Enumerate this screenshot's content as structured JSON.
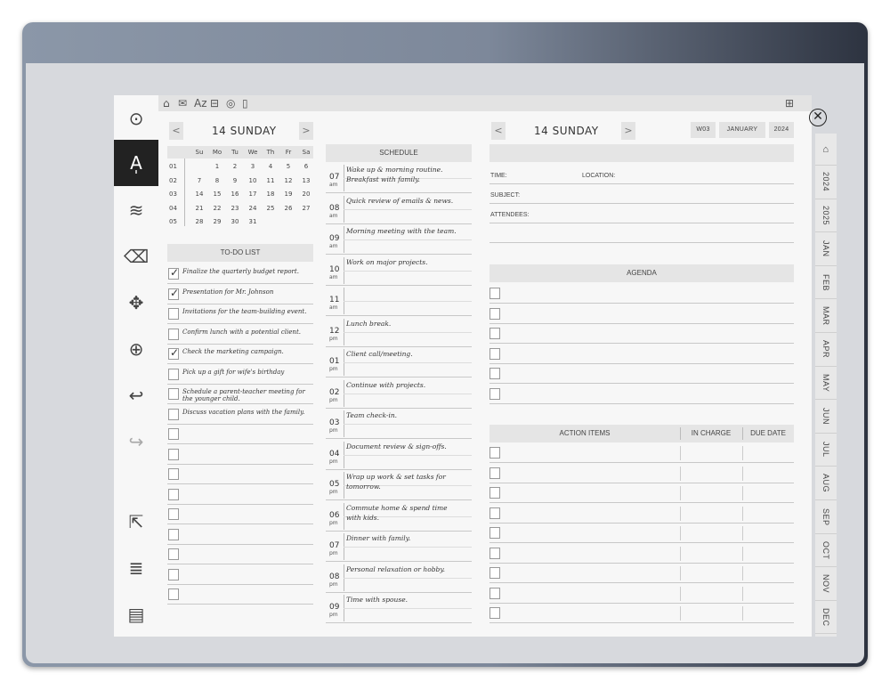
{
  "toolbar": {
    "icons": [
      "home-icon",
      "mail-icon",
      "sort-icon",
      "briefcase-icon",
      "target-icon",
      "document-icon",
      "grid-icon"
    ]
  },
  "rail": {
    "items": [
      "circle-dot-icon",
      "pen-icon",
      "brush-icon",
      "eraser-icon",
      "move-icon",
      "zoom-in-icon",
      "undo-icon",
      "redo-icon",
      "share-icon",
      "layers-icon",
      "notebook-icon"
    ]
  },
  "left_page": {
    "day_title": "14 SUNDAY",
    "prev": "<",
    "next": ">",
    "calendar": {
      "weekdays": [
        "Su",
        "Mo",
        "Tu",
        "We",
        "Th",
        "Fr",
        "Sa"
      ],
      "weeks": [
        {
          "num": "01",
          "days": [
            "",
            "1",
            "2",
            "3",
            "4",
            "5",
            "6"
          ]
        },
        {
          "num": "02",
          "days": [
            "7",
            "8",
            "9",
            "10",
            "11",
            "12",
            "13"
          ]
        },
        {
          "num": "03",
          "days": [
            "14",
            "15",
            "16",
            "17",
            "18",
            "19",
            "20"
          ]
        },
        {
          "num": "04",
          "days": [
            "21",
            "22",
            "23",
            "24",
            "25",
            "26",
            "27"
          ]
        },
        {
          "num": "05",
          "days": [
            "28",
            "29",
            "30",
            "31",
            "",
            "",
            ""
          ]
        }
      ]
    },
    "todo_title": "TO-DO LIST",
    "todos": [
      {
        "text": "Finalize the quarterly budget report.",
        "checked": true
      },
      {
        "text": "Presentation for Mr. Johnson",
        "checked": true
      },
      {
        "text": "Invitations for the team-building event.",
        "checked": false
      },
      {
        "text": "Confirm lunch with a potential client.",
        "checked": false
      },
      {
        "text": "Check the marketing campaign.",
        "checked": true
      },
      {
        "text": "Pick up a gift for wife's birthday",
        "checked": false
      },
      {
        "text": "Schedule a parent-teacher meeting for\nthe younger child.",
        "checked": false
      },
      {
        "text": "Discuss vacation plans with the family.",
        "checked": false
      },
      {
        "text": "",
        "checked": false
      },
      {
        "text": "",
        "checked": false
      },
      {
        "text": "",
        "checked": false
      },
      {
        "text": "",
        "checked": false
      },
      {
        "text": "",
        "checked": false
      },
      {
        "text": "",
        "checked": false
      },
      {
        "text": "",
        "checked": false
      },
      {
        "text": "",
        "checked": false
      },
      {
        "text": "",
        "checked": false
      }
    ],
    "schedule_title": "SCHEDULE",
    "schedule": [
      {
        "hour": "07",
        "ampm": "am",
        "text": "Wake up & morning routine.\nBreakfast with family."
      },
      {
        "hour": "08",
        "ampm": "am",
        "text": "Quick review of emails & news."
      },
      {
        "hour": "09",
        "ampm": "am",
        "text": "Morning meeting with the team."
      },
      {
        "hour": "10",
        "ampm": "am",
        "text": "Work on major projects."
      },
      {
        "hour": "11",
        "ampm": "am",
        "text": ""
      },
      {
        "hour": "12",
        "ampm": "pm",
        "text": "Lunch break."
      },
      {
        "hour": "01",
        "ampm": "pm",
        "text": "Client call/meeting."
      },
      {
        "hour": "02",
        "ampm": "pm",
        "text": "Continue with projects."
      },
      {
        "hour": "03",
        "ampm": "pm",
        "text": "Team check-in."
      },
      {
        "hour": "04",
        "ampm": "pm",
        "text": "Document review & sign-offs."
      },
      {
        "hour": "05",
        "ampm": "pm",
        "text": "Wrap up work & set tasks for\ntomorrow."
      },
      {
        "hour": "06",
        "ampm": "pm",
        "text": "Commute home & spend time\nwith kids."
      },
      {
        "hour": "07",
        "ampm": "pm",
        "text": "Dinner with family."
      },
      {
        "hour": "08",
        "ampm": "pm",
        "text": "Personal relaxation or hobby."
      },
      {
        "hour": "09",
        "ampm": "pm",
        "text": "Time with spouse."
      }
    ]
  },
  "right_page": {
    "day_title": "14 SUNDAY",
    "prev": "<",
    "next": ">",
    "week": "W03",
    "month": "JANUARY",
    "year": "2024",
    "fields": {
      "time": "TIME:",
      "location": "LOCATION:",
      "subject": "SUBJECT:",
      "attendees": "ATTENDEES:"
    },
    "agenda_title": "AGENDA",
    "agenda_rows": 6,
    "action_title": "ACTION ITEMS",
    "in_charge": "IN CHARGE",
    "due_date": "DUE DATE",
    "action_rows": 9
  },
  "side_tabs": [
    "2024",
    "2025",
    "JAN",
    "FEB",
    "MAR",
    "APR",
    "MAY",
    "JUN",
    "JUL",
    "AUG",
    "SEP",
    "OCT",
    "NOV",
    "DEC"
  ],
  "colors": {
    "active_rail": "#222222",
    "header_bg": "#e5e5e5",
    "page_bg": "#f7f7f7",
    "frame": "#7d889a"
  }
}
